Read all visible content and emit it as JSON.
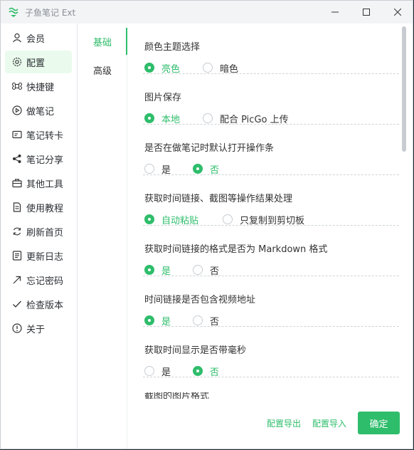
{
  "window": {
    "title": "子鱼笔记 Ext",
    "accent_color": "#2ebd6b",
    "active_bg": "#eafbee"
  },
  "sidebar": {
    "items": [
      {
        "label": "会员",
        "icon": "user-icon"
      },
      {
        "label": "配置",
        "icon": "gear-icon",
        "active": true
      },
      {
        "label": "快捷键",
        "icon": "command-key-icon"
      },
      {
        "label": "做笔记",
        "icon": "play-circle-icon"
      },
      {
        "label": "笔记转卡",
        "icon": "card-icon"
      },
      {
        "label": "笔记分享",
        "icon": "share-icon"
      },
      {
        "label": "其他工具",
        "icon": "toolbox-icon"
      },
      {
        "label": "使用教程",
        "icon": "document-icon"
      },
      {
        "label": "刷新首页",
        "icon": "refresh-icon"
      },
      {
        "label": "更新日志",
        "icon": "log-icon"
      },
      {
        "label": "忘记密码",
        "icon": "arrow-up-right-icon"
      },
      {
        "label": "检查版本",
        "icon": "check-icon"
      },
      {
        "label": "关于",
        "icon": "info-icon"
      }
    ]
  },
  "subnav": {
    "tabs": [
      {
        "label": "基础",
        "active": true
      },
      {
        "label": "高级",
        "active": false
      }
    ]
  },
  "settings": [
    {
      "question": "颜色主题选择",
      "options": [
        "亮色",
        "暗色"
      ],
      "selected": 0
    },
    {
      "question": "图片保存",
      "options": [
        "本地",
        "配合 PicGo 上传"
      ],
      "selected": 0
    },
    {
      "question": "是否在做笔记时默认打开操作条",
      "options": [
        "是",
        "否"
      ],
      "selected": 1
    },
    {
      "question": "获取时间链接、截图等操作结果处理",
      "options": [
        "自动粘贴",
        "只复制到剪切板"
      ],
      "selected": 0
    },
    {
      "question": "获取时间链接的格式是否为 Markdown 格式",
      "options": [
        "是",
        "否"
      ],
      "selected": 0
    },
    {
      "question": "时间链接是否包含视频地址",
      "options": [
        "是",
        "否"
      ],
      "selected": 0
    },
    {
      "question": "获取时间显示是否带毫秒",
      "options": [
        "是",
        "否"
      ],
      "selected": 1
    }
  ],
  "partial_next": "截图的图片格式",
  "footer": {
    "export_label": "配置导出",
    "import_label": "配置导入",
    "confirm_label": "确定"
  }
}
